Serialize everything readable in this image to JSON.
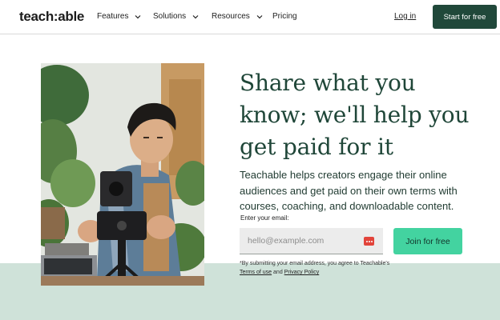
{
  "nav": {
    "logo": "teach:able",
    "items": [
      {
        "label": "Features",
        "has_dropdown": true
      },
      {
        "label": "Solutions",
        "has_dropdown": true
      },
      {
        "label": "Resources",
        "has_dropdown": true
      },
      {
        "label": "Pricing",
        "has_dropdown": false
      }
    ],
    "login": "Log in",
    "cta": "Start for free"
  },
  "hero": {
    "headline": "Share what you know; we'll help you get paid for it",
    "subheading": "Teachable helps creators engage their online audiences and get paid on their own terms with courses, coaching, and downloadable content.",
    "email_label": "Enter your email:",
    "email_placeholder": "hello@example.com",
    "join_button": "Join for free",
    "legal": {
      "prefix": "*By submitting your email address, you agree to Teachable's",
      "terms": "Terms of use",
      "and": "and",
      "privacy": "Privacy Policy"
    }
  },
  "colors": {
    "primary_dark_green": "#20483a",
    "headline_green": "#1f4638",
    "accent_mint": "#43d3a0",
    "band_mint": "#cfe2d9",
    "password_manager_red": "#e2443b"
  },
  "icons": {
    "dropdown": "chevron-down-icon",
    "password_manager": "password-manager-icon"
  }
}
